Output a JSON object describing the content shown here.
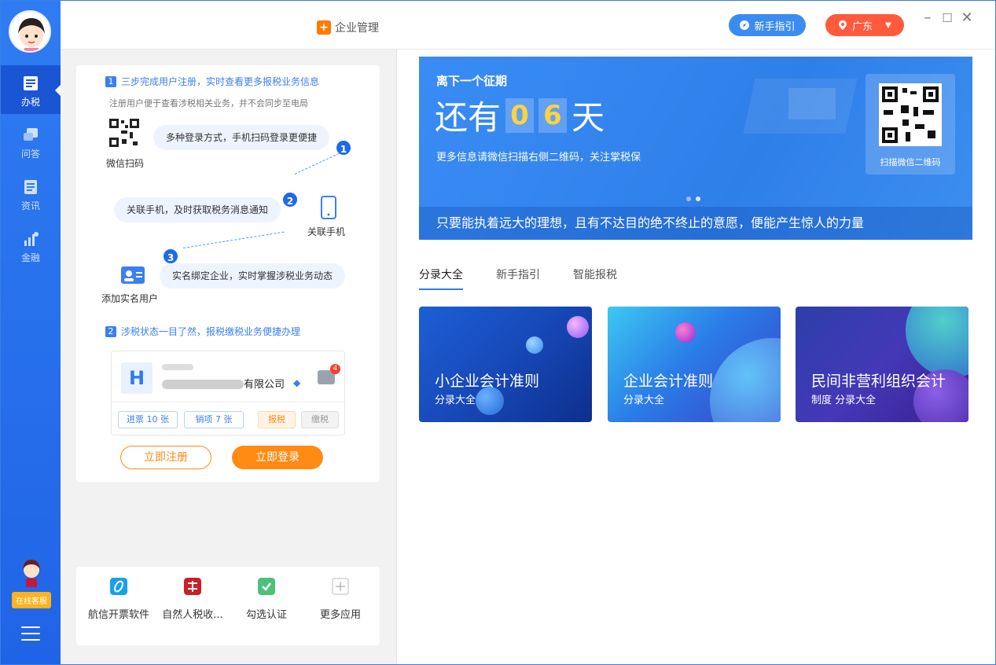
{
  "window": {
    "title": "企业管理"
  },
  "topbar": {
    "guide_label": "新手指引",
    "region_label": "广东",
    "colors": {
      "guide": "#3b8cf0",
      "region": "#ff5a3c"
    }
  },
  "sidebar": {
    "items": [
      {
        "label": "办税",
        "icon": "tax-icon",
        "active": true
      },
      {
        "label": "问答",
        "icon": "qa-icon",
        "active": false
      },
      {
        "label": "资讯",
        "icon": "news-icon",
        "active": false
      },
      {
        "label": "金融",
        "icon": "finance-icon",
        "active": false
      }
    ],
    "customer_service_label": "在线客服"
  },
  "register_card": {
    "step1": {
      "num": "1",
      "title": "三步完成用户注册，实时查看更多报税业务信息",
      "note": "注册用户便于查看涉税相关业务，并不会同步至电局"
    },
    "flow": [
      {
        "num": "1",
        "text": "多种登录方式，手机扫码登录更便捷",
        "side_label": "微信扫码"
      },
      {
        "num": "2",
        "text": "关联手机，及时获取税务消息通知",
        "side_label": "关联手机"
      },
      {
        "num": "3",
        "text": "实名绑定企业，实时掌握涉税业务动态",
        "side_label": "添加实名用户"
      }
    ],
    "step2": {
      "num": "2",
      "title": "涉税状态一目了然，报税缴税业务便捷办理"
    },
    "company": {
      "logo_letter": "H",
      "name_suffix": "有限公司",
      "msg_count": "4",
      "chips": [
        "进票 10 张",
        "销项 7 张",
        "报税",
        "缴税"
      ]
    },
    "register_btn": "立即注册",
    "login_btn": "立即登录"
  },
  "apps": [
    {
      "label": "航信开票软件",
      "icon": "aisino-icon",
      "color": "#1aa0e8"
    },
    {
      "label": "自然人税收...",
      "icon": "personal-tax-icon",
      "color": "#c8202a"
    },
    {
      "label": "勾选认证",
      "icon": "check-cert-icon",
      "color": "#4cc17a"
    },
    {
      "label": "更多应用",
      "icon": "plus-icon",
      "color": "#bbbbbb"
    }
  ],
  "banner": {
    "title": "离下一个征期",
    "prefix": "还有",
    "digits": [
      "0",
      "6"
    ],
    "suffix": "天",
    "subtitle": "更多信息请微信扫描右侧二维码，关注掌税保",
    "qr_label": "扫描微信二维码",
    "quote": "只要能执着远大的理想，且有不达目的绝不终止的意愿，便能产生惊人的力量"
  },
  "tabs": [
    {
      "label": "分录大全",
      "active": true
    },
    {
      "label": "新手指引",
      "active": false
    },
    {
      "label": "智能报税",
      "active": false
    }
  ],
  "tiles": [
    {
      "title": "小企业会计准则",
      "sub": "分录大全"
    },
    {
      "title": "企业会计准则",
      "sub": "分录大全"
    },
    {
      "title": "民间非营利组织会计",
      "sub": "制度 分录大全"
    }
  ]
}
